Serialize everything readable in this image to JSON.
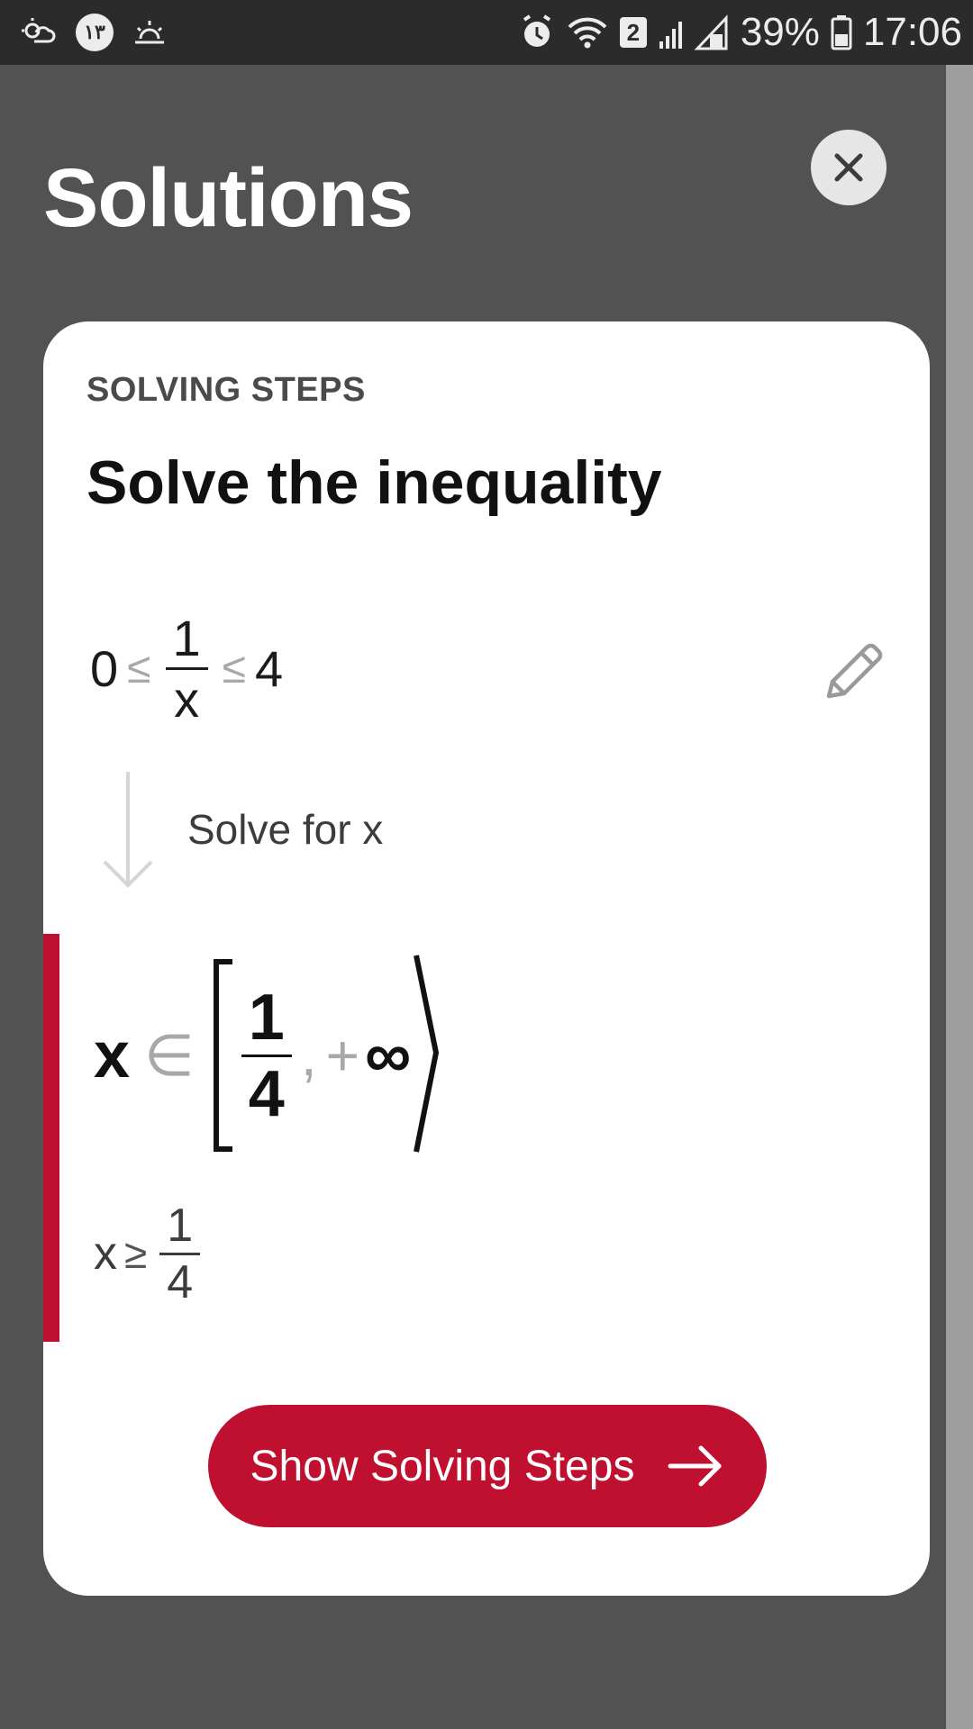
{
  "status_bar": {
    "left_badge": "١٣",
    "sim_number": "2",
    "battery_percent": "39%",
    "time": "17:06",
    "icons": [
      "weather-icon",
      "sun-icon",
      "alarm-icon",
      "wifi-icon",
      "signal-icon",
      "battery-icon"
    ]
  },
  "header": {
    "title": "Solutions"
  },
  "card": {
    "section_label": "SOLVING STEPS",
    "heading": "Solve the inequality",
    "problem": {
      "left": "0",
      "op1": "≤",
      "frac_num": "1",
      "frac_den": "x",
      "op2": "≤",
      "right": "4"
    },
    "step_label": "Solve for x",
    "result": {
      "var": "x",
      "op": "∈",
      "lo_num": "1",
      "lo_den": "4",
      "comma": ",",
      "plus": "+",
      "hi": "∞",
      "alt_var": "x",
      "alt_op": "≥",
      "alt_num": "1",
      "alt_den": "4"
    },
    "cta_label": "Show Solving Steps"
  },
  "colors": {
    "accent": "#c0102f",
    "overlay": "#525252",
    "status_bar": "#2b2b2b",
    "card": "#ffffff"
  }
}
